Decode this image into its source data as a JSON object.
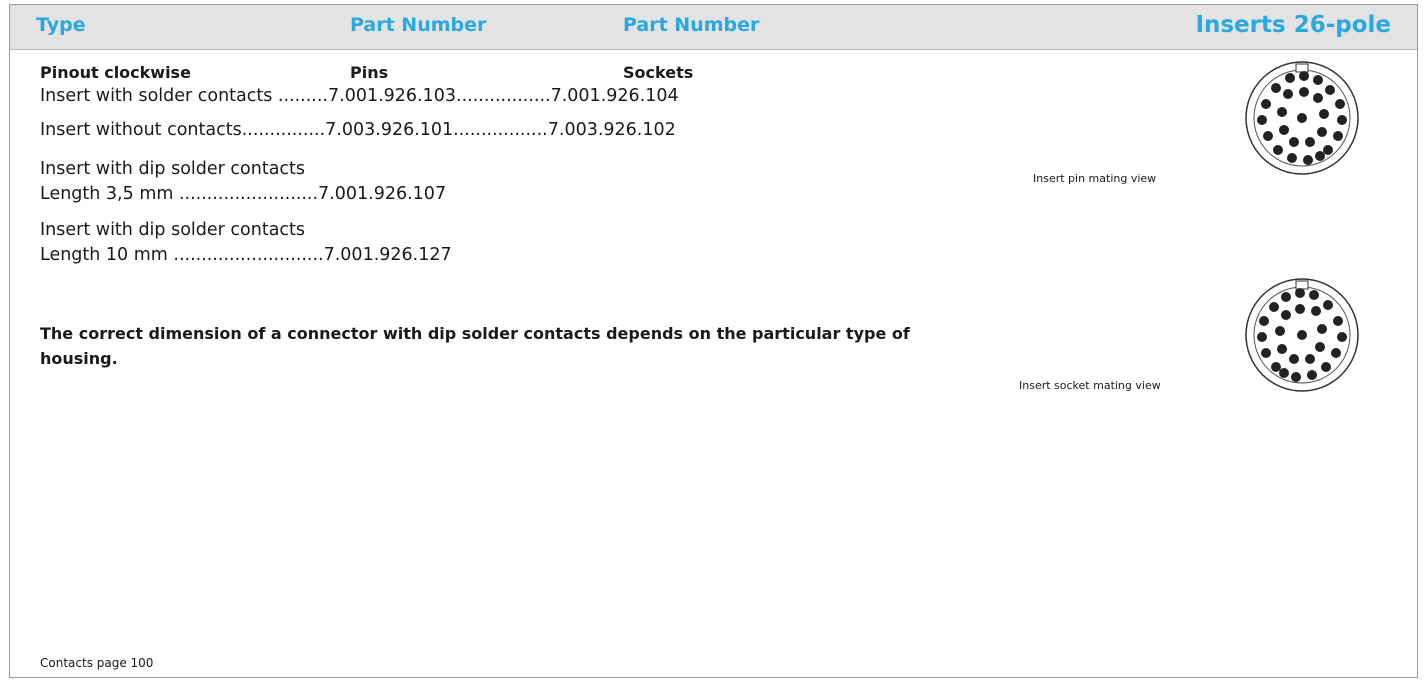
{
  "header": {
    "col_type": "Type",
    "col_part1": "Part Number",
    "col_part2": "Part Number",
    "title": "Inserts 26-pole"
  },
  "subheader": {
    "pinout": "Pinout clockwise",
    "pins": "Pins",
    "sockets": "Sockets"
  },
  "rows": [
    "Insert with solder contacts .........7.001.926.103.................7.001.926.104",
    "Insert without contacts...............7.003.926.101.................7.003.926.102",
    "Insert with dip solder contacts",
    "Length 3,5 mm .........................7.001.926.107",
    "Insert with dip solder contacts",
    "Length 10 mm ...........................7.001.926.127"
  ],
  "note": "The correct dimension of a connector with dip solder contacts depends on the particular type of housing.",
  "captions": {
    "pin_view": "Insert pin mating view",
    "socket_view": "Insert socket mating view"
  },
  "footer": "Contacts page 100"
}
